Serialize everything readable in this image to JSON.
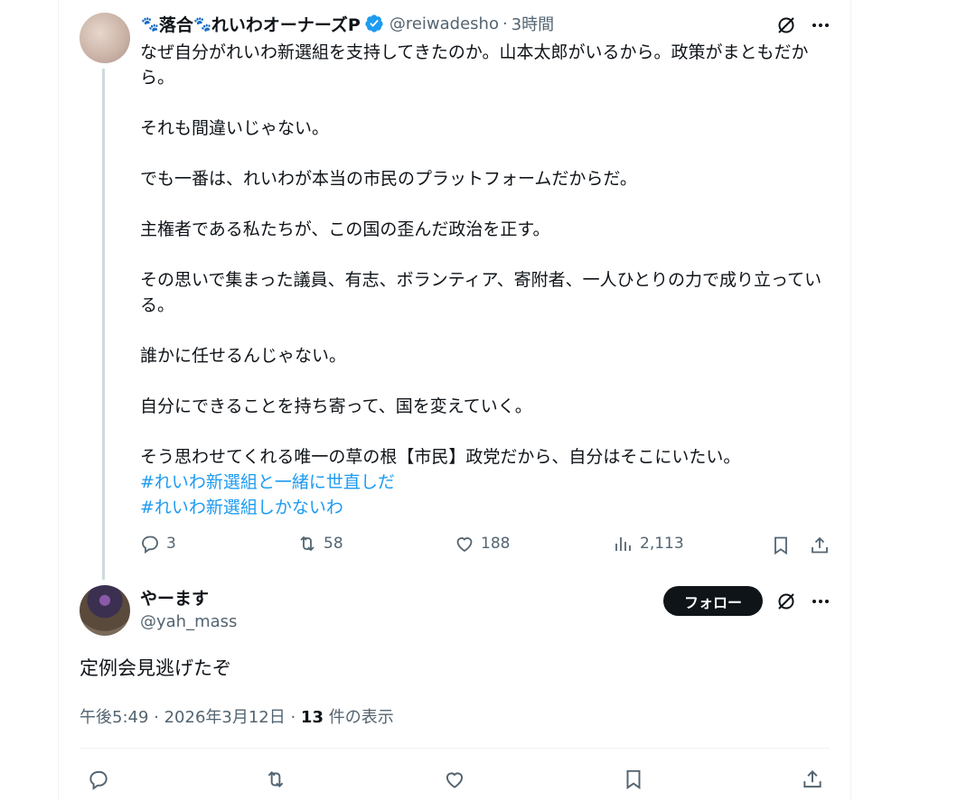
{
  "tweet": {
    "display_name": "落合",
    "display_name_2": "れいわオーナーズP",
    "handle": "@reiwadesho",
    "time": "3時間",
    "paragraphs": [
      "なぜ自分がれいわ新選組を支持してきたのか。山本太郎がいるから。政策がまともだから。",
      "それも間違いじゃない。",
      "でも一番は、れいわが本当の市民のプラットフォームだからだ。",
      "主権者である私たちが、この国の歪んだ政治を正す。",
      "その思いで集まった議員、有志、ボランティア、寄附者、一人ひとりの力で成り立っている。",
      "誰かに任せるんじゃない。",
      "自分にできることを持ち寄って、国を変えていく。",
      "そう思わせてくれる唯一の草の根【市民】政党だから、自分はそこにいたい。"
    ],
    "hashtags": [
      "#れいわ新選組と一緒に世直しだ",
      "#れいわ新選組しかないわ"
    ],
    "stats": {
      "replies": "3",
      "reposts": "58",
      "likes": "188",
      "views": "2,113"
    }
  },
  "reply": {
    "display_name": "やーます",
    "handle": "@yah_mass",
    "follow_label": "フォロー",
    "text": "定例会見逃げたぞ",
    "timestamp": "午後5:49 · 2026年3月12日 · ",
    "views_count": "13",
    "views_label": " 件の表示"
  },
  "colors": {
    "accent": "#1d9bf0",
    "text_primary": "#0f1419",
    "text_secondary": "#536471"
  },
  "icons": [
    "verified-badge-icon",
    "grok-icon",
    "more-icon",
    "reply-icon",
    "repost-icon",
    "like-icon",
    "views-icon",
    "bookmark-icon",
    "share-icon",
    "paw-icon"
  ]
}
